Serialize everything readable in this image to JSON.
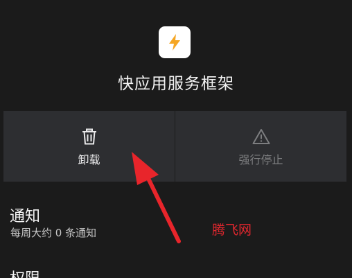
{
  "app": {
    "name": "快应用服务框架",
    "icon": "lightning-bolt-icon"
  },
  "actions": {
    "uninstall_label": "卸载",
    "uninstall_icon": "trash-icon",
    "force_stop_label": "强行停止",
    "force_stop_icon": "warning-triangle-icon"
  },
  "notifications": {
    "title": "通知",
    "subtitle": "每周大约 0 条通知"
  },
  "permissions": {
    "title": "权限"
  },
  "watermark": "腾飞网",
  "colors": {
    "background": "#1b1b1b",
    "button_background": "#2d2e31",
    "annotation_red": "#e8252b",
    "bolt_orange": "#f5a623"
  }
}
